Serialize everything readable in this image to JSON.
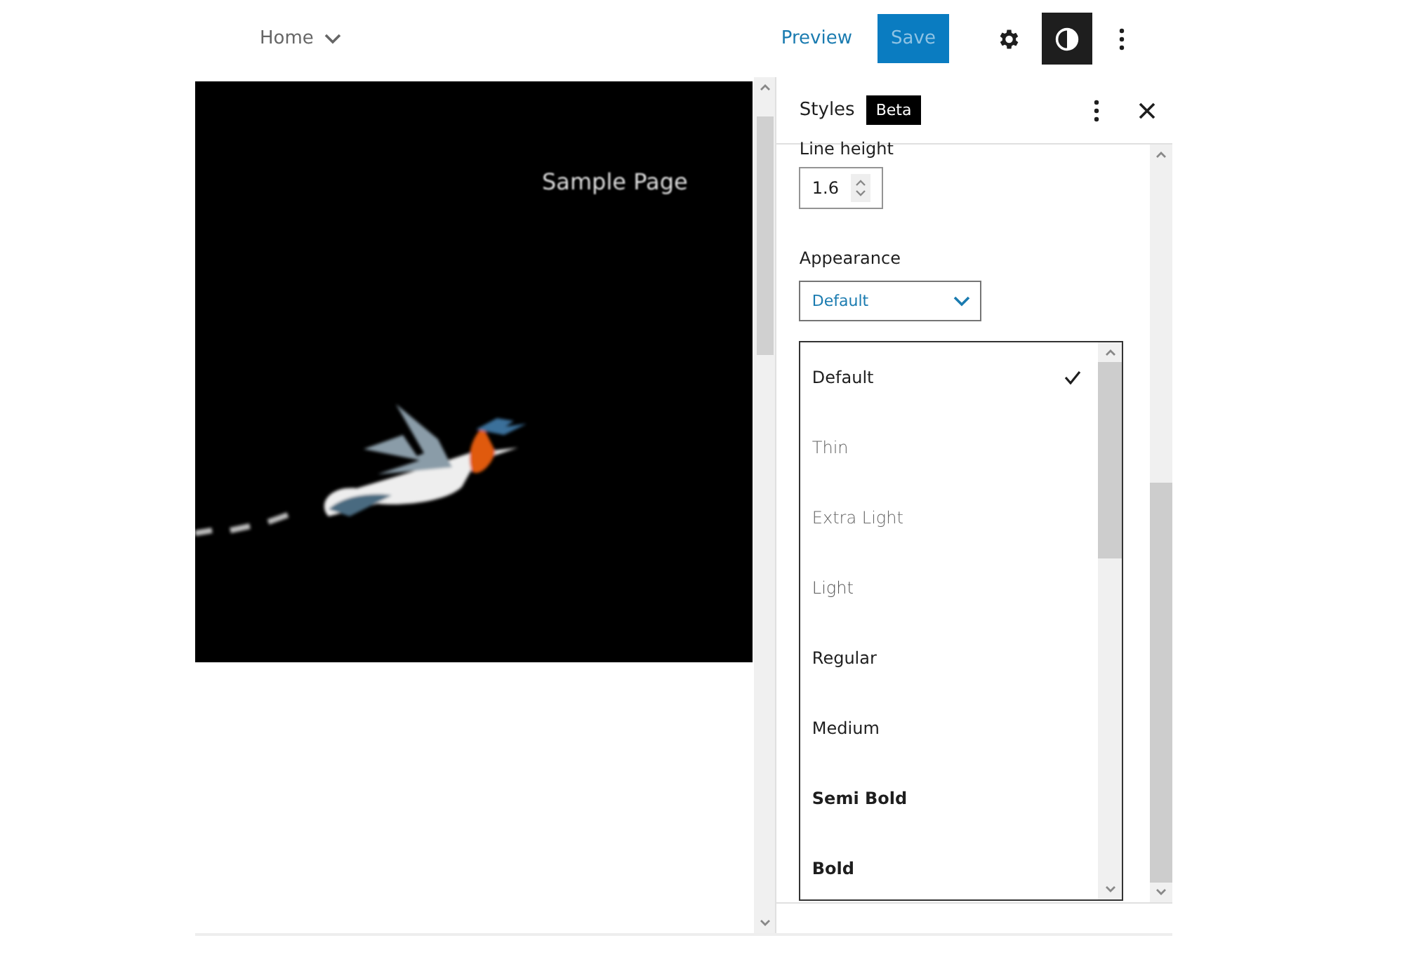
{
  "top_bar": {
    "breadcrumb": "Home",
    "preview": "Preview",
    "save": {
      "label": "Save",
      "disabled": true
    },
    "styles_toggle": {
      "selected": true
    }
  },
  "canvas": {
    "site_title": "Sample Page"
  },
  "sidebar": {
    "title": "Styles",
    "badge": "Beta",
    "line_height": {
      "label": "Line height",
      "value": "1.6"
    },
    "appearance": {
      "label": "Appearance",
      "value": "Default",
      "options": [
        {
          "label": "Default",
          "kind": "default",
          "selected": true
        },
        {
          "label": "Thin",
          "kind": "thin",
          "selected": false
        },
        {
          "label": "Extra Light",
          "kind": "extra-light",
          "selected": false
        },
        {
          "label": "Light",
          "kind": "light",
          "selected": false
        },
        {
          "label": "Regular",
          "kind": "regular",
          "selected": false
        },
        {
          "label": "Medium",
          "kind": "medium",
          "selected": false
        },
        {
          "label": "Semi Bold",
          "kind": "semi-bold",
          "selected": false
        },
        {
          "label": "Bold",
          "kind": "bold",
          "selected": false
        }
      ]
    }
  }
}
